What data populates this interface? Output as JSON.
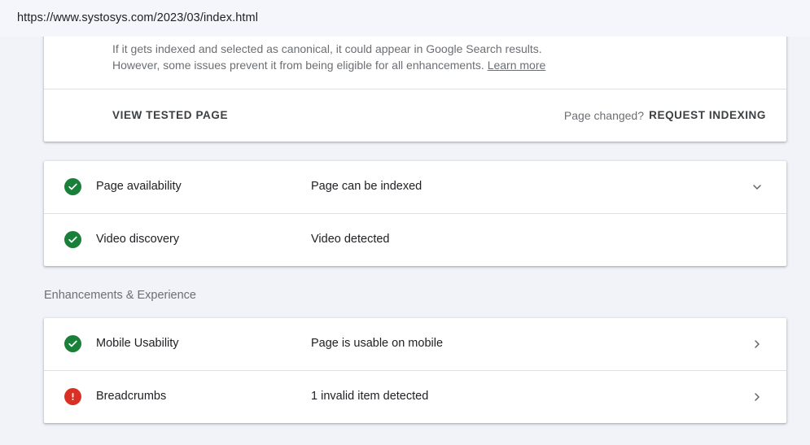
{
  "browser": {
    "url": "https://www.systosys.com/2023/03/index.html"
  },
  "result_card": {
    "line1": "If it gets indexed and selected as canonical, it could appear in Google Search results.",
    "line2": "However, some issues prevent it from being eligible for all enhancements. ",
    "learn_more": "Learn more",
    "view_tested_page": "VIEW TESTED PAGE",
    "page_changed": "Page changed?",
    "request_indexing": "REQUEST INDEXING"
  },
  "checks": [
    {
      "label": "Page availability",
      "value": "Page can be indexed",
      "status": "ok",
      "control": "chevron-down-icon"
    },
    {
      "label": "Video discovery",
      "value": "Video detected",
      "status": "ok"
    }
  ],
  "enhancements": {
    "title": "Enhancements & Experience",
    "items": [
      {
        "label": "Mobile Usability",
        "value": "Page is usable on mobile",
        "status": "ok",
        "control": "chevron-right-icon"
      },
      {
        "label": "Breadcrumbs",
        "value": "1 invalid item detected",
        "status": "error",
        "control": "chevron-right-icon"
      }
    ]
  },
  "colors": {
    "ok": "#188038",
    "error": "#d93025",
    "background": "#f1f3f9"
  }
}
